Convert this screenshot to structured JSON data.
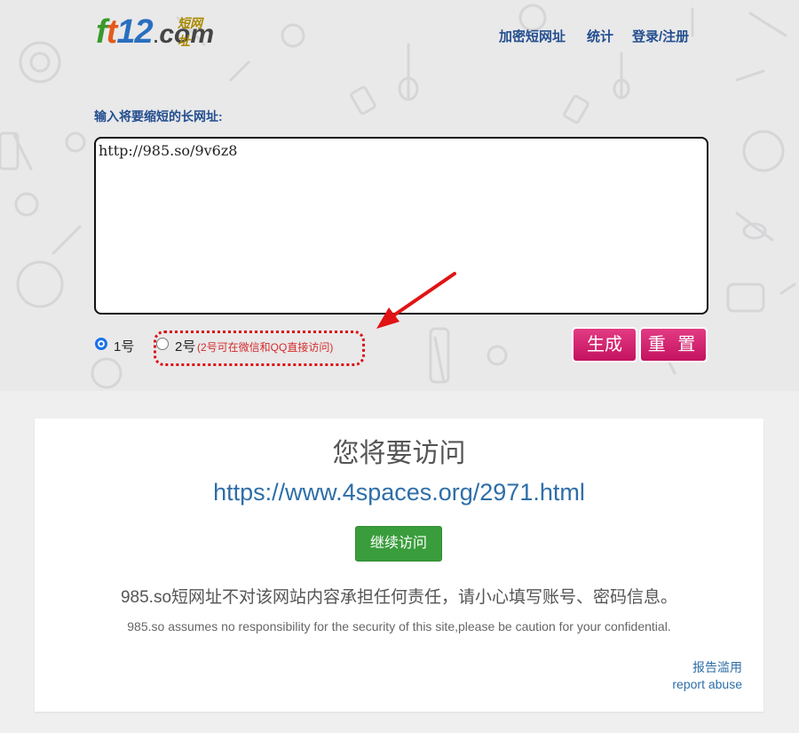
{
  "header": {
    "logo": {
      "big_f": "f",
      "big_t": "t",
      "big_1": "1",
      "big_2": "2",
      "dot": ".",
      "com": "com",
      "sub": "短网址"
    },
    "nav": [
      {
        "label": "加密短网址"
      },
      {
        "label": "统计"
      },
      {
        "label": "登录/注册"
      }
    ]
  },
  "form": {
    "label": "输入将要缩短的长网址:",
    "url_value": "http://985.so/9v6z8",
    "option1_label": "1号",
    "option2_label": "2号",
    "option2_hint": "(2号可在微信和QQ直接访问)",
    "option_selected": "1号",
    "generate_label": "生成",
    "reset_label": "重 置"
  },
  "result": {
    "title": "您将要访问",
    "url": "https://www.4spaces.org/2971.html",
    "continue_label": "继续访问",
    "disclaimer_cn": "985.so短网址不对该网站内容承担任何责任，请小心填写账号、密码信息。",
    "disclaimer_en": "985.so assumes no responsibility for the security of this site,please be caution for your confidential.",
    "report_cn": "报告滥用",
    "report_en": "report abuse"
  },
  "colors": {
    "accent": "#c4125f",
    "link": "#2e6ea8",
    "nav": "#244f8f",
    "continue": "#3a9d3c",
    "hint": "#d62b2b"
  }
}
